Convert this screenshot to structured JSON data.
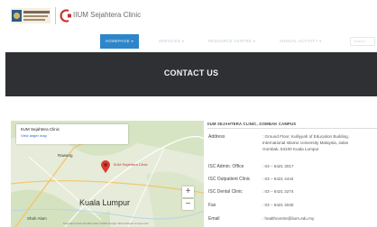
{
  "header": {
    "clinic_name": "IIUM Sejahtera Clinic"
  },
  "nav": {
    "items": [
      "Homepage",
      "Services",
      "Resource Centre",
      "Annual Activity"
    ],
    "search_placeholder": "Search"
  },
  "banner": {
    "title": "CONTACT US"
  },
  "map": {
    "card_title": "IIUM Sejahtera Clinic",
    "card_link": "View larger map",
    "marker_label": "IIUM Sejahtera Clinic",
    "places": [
      "Rawang",
      "Kuala Lumpur",
      "Shah Alam"
    ],
    "footer": "Keyboard shortcuts   Map data ©2023 Google   Terms   Report a map error"
  },
  "contact": {
    "heading": "IIUM SEJAHTERA CLINIC, GOMBAK CAMPUS",
    "rows": [
      {
        "label": "Address",
        "value": ": Ground Floor, Kulliyyah of Education Building,\nInternational Islamic University Malaysia, Jalan\nGombak, 53100 Kuala Lumpur"
      },
      {
        "label": "ISC Admin. Office",
        "value": ": 03 – 6421 3017"
      },
      {
        "label": "ISC Outpatient Clinic",
        "value": ": 03 – 6421 4444"
      },
      {
        "label": "ISC Dental Clinic",
        "value": ": 03 – 6421 3274"
      },
      {
        "label": "Fax",
        "value": ": 03 – 6421 4040"
      },
      {
        "label": "Email",
        "value": ": healthcentre@iium.edu.my"
      }
    ]
  },
  "colors": {
    "nav_active": "#2e86c9",
    "banner_bg": "#2f3033",
    "clinic_red": "#c4352d"
  }
}
